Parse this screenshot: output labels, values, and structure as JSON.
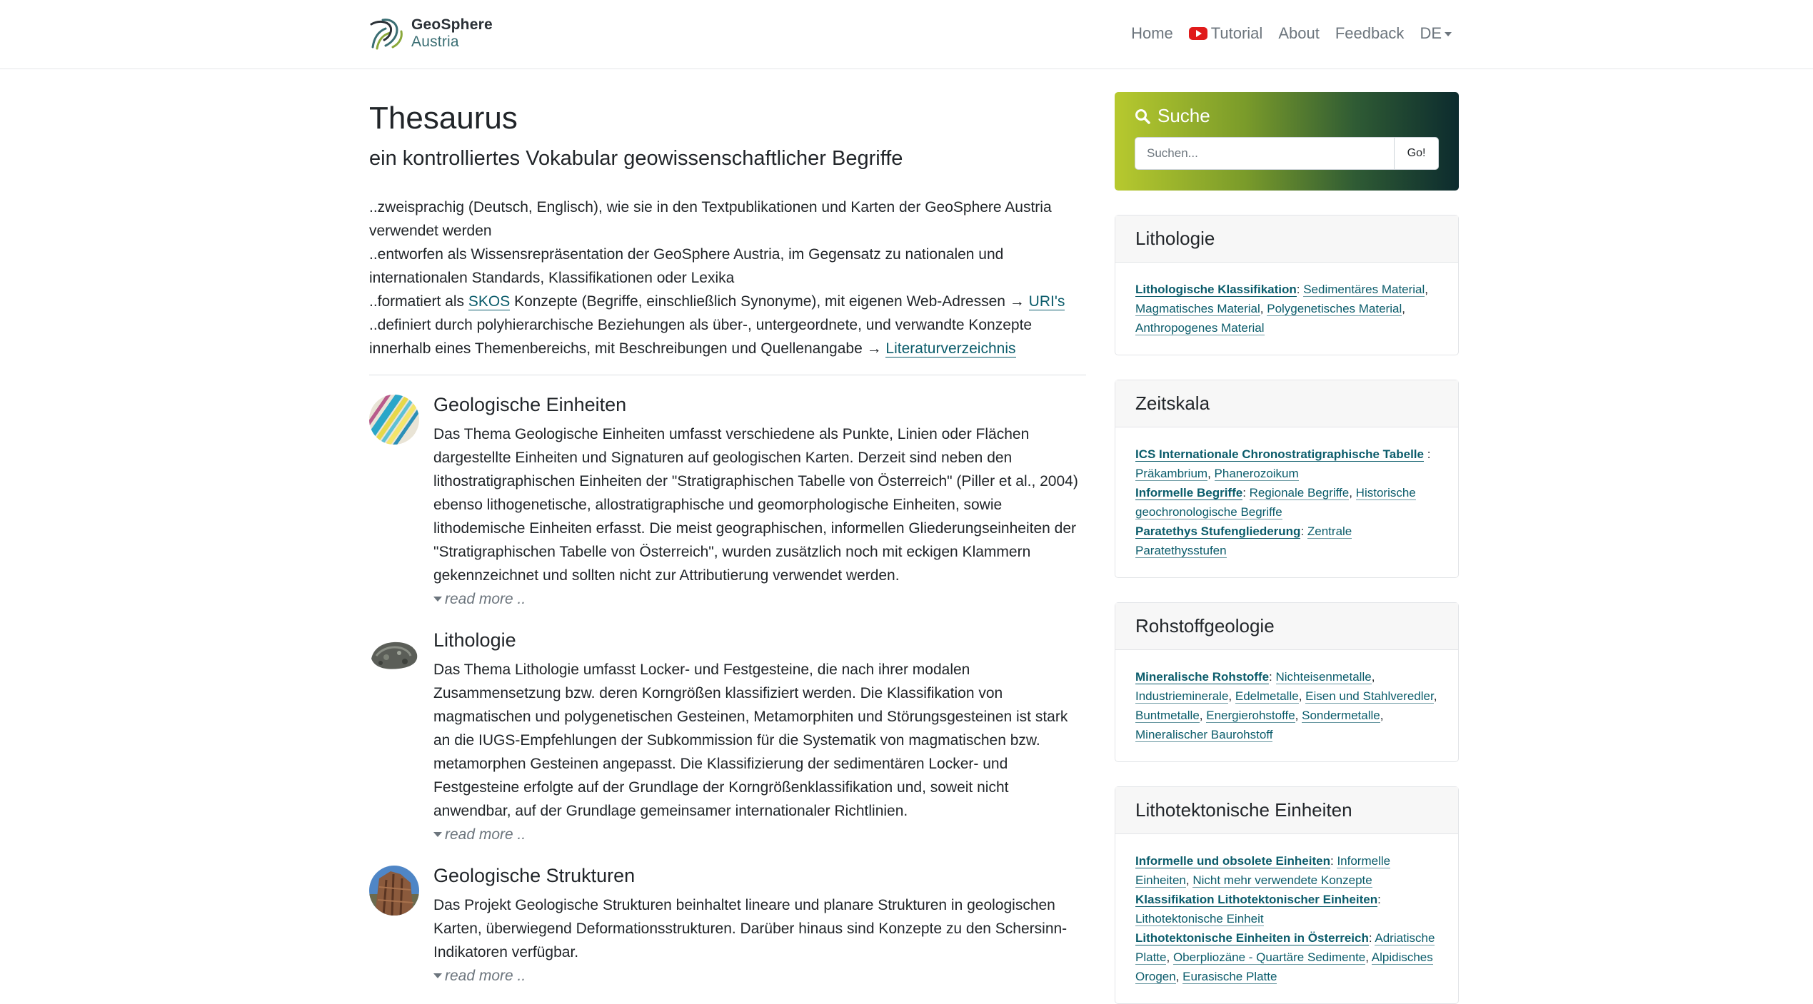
{
  "brand": {
    "line1": "GeoSphere",
    "line2": "Austria"
  },
  "nav": {
    "home": "Home",
    "tutorial": "Tutorial",
    "about": "About",
    "feedback": "Feedback",
    "language": "DE"
  },
  "page": {
    "title": "Thesaurus",
    "subtitle": "ein kontrolliertes Vokabular geowissenschaftlicher Begriffe"
  },
  "intro": {
    "line1": "..zweisprachig (Deutsch, Englisch), wie sie in den Textpublikationen und Karten der GeoSphere Austria verwendet werden",
    "line2": "..entworfen als Wissensrepräsentation der GeoSphere Austria, im Gegensatz zu nationalen und internationalen Standards, Klassifikationen oder Lexika",
    "line3_pre": "..formatiert als ",
    "line3_skos": "SKOS",
    "line3_mid": " Konzepte (Begriffe, einschließlich Synonyme), mit eigenen Web-Adressen → ",
    "line3_uris": "URI's",
    "line4_pre": "..definiert durch polyhierarchische Beziehungen als über-, untergeordnete, und verwandte Konzepte innerhalb eines Themenbereichs, mit Beschreibungen und Quellenangabe → ",
    "line4_lit": "Literaturverzeichnis"
  },
  "topics": [
    {
      "title": "Geologische Einheiten",
      "text": "Das Thema Geologische Einheiten umfasst verschiedene als Punkte, Linien oder Flächen dargestellte Einheiten und Signaturen auf geologischen Karten. Derzeit sind neben den lithostratigraphischen Einheiten der \"Stratigraphischen Tabelle von Österreich\" (Piller et al., 2004) ebenso lithogenetische, allostratigraphische und geomorphologische Einheiten, sowie lithodemische Einheiten erfasst. Die meist geographischen, informellen Gliederungseinheiten der \"Stratigraphischen Tabelle von Österreich\", wurden zusätzlich noch mit eckigen Klammern gekennzeichnet und sollten nicht zur Attributierung verwendet werden.",
      "readmore": "read more .."
    },
    {
      "title": "Lithologie",
      "text": "Das Thema Lithologie umfasst Locker- und Festgesteine, die nach ihrer modalen Zusammensetzung bzw. deren Korngrößen klassifiziert werden. Die Klassifikation von magmatischen und polygenetischen Gesteinen, Metamorphiten und Störungsgesteinen ist stark an die IUGS-Empfehlungen der Subkommission für die Systematik von magmatischen bzw. metamorphen Gesteinen angepasst. Die Klassifizierung der sedimentären Locker- und Festgesteine erfolgte auf der Grundlage der Korngrößenklassifikation und, soweit nicht anwendbar, auf der Grundlage gemeinsamer internationaler Richtlinien.",
      "readmore": "read more .."
    },
    {
      "title": "Geologische Strukturen",
      "text": "Das Projekt Geologische Strukturen beinhaltet lineare und planare Strukturen in geologischen Karten, überwiegend Deformationsstrukturen. Darüber hinaus sind Konzepte zu den Schersinn-Indikatoren verfügbar.",
      "readmore": "read more .."
    }
  ],
  "search": {
    "title": "Suche",
    "placeholder": "Suchen...",
    "button": "Go!"
  },
  "cards": {
    "lithologie": {
      "title": "Lithologie",
      "h1": "Lithologische Klassifikation",
      "l1": "Sedimentäres Material",
      "l2": "Magmatisches Material",
      "l3": "Polygenetisches Material",
      "l4": "Anthropogenes Material"
    },
    "zeitskala": {
      "title": "Zeitskala",
      "h1": "ICS Internationale Chronostratigraphische Tabelle",
      "l1": "Präkambrium",
      "l2": "Phanerozoikum",
      "h2": "Informelle Begriffe",
      "l3": "Regionale Begriffe",
      "l4": "Historische geochronologische Begriffe",
      "h3": "Paratethys Stufengliederung",
      "l5": "Zentrale Paratethysstufen"
    },
    "rohstoff": {
      "title": "Rohstoffgeologie",
      "h1": "Mineralische Rohstoffe",
      "l1": "Nichteisenmetalle",
      "l2": "Industrieminerale",
      "l3": "Edelmetalle",
      "l4": "Eisen und Stahlveredler",
      "l5": "Buntmetalle",
      "l6": "Energierohstoffe",
      "l7": "Sondermetalle",
      "l8": "Mineralischer Baurohstoff"
    },
    "lithotekt": {
      "title": "Lithotektonische Einheiten",
      "h1": "Informelle und obsolete Einheiten",
      "l1": "Informelle Einheiten",
      "l2": "Nicht mehr verwendete Konzepte",
      "h2": "Klassifikation Lithotektonischer Einheiten",
      "l3": "Lithotektonische Einheit",
      "h3": "Lithotektonische Einheiten in Österreich",
      "l4": "Adriatische Platte",
      "l5": "Oberpliozäne - Quartäre Sedimente",
      "l6": "Alpidisches Orogen",
      "l7": "Eurasische Platte"
    }
  }
}
